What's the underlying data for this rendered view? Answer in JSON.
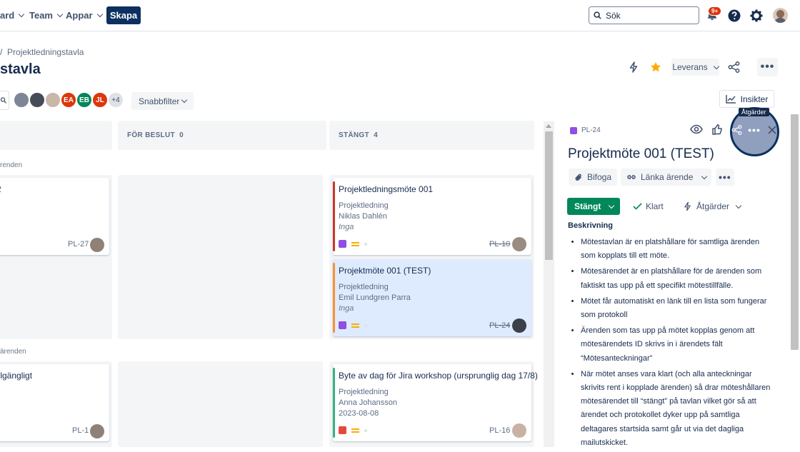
{
  "nav": {
    "items": [
      "ard",
      "Team",
      "Appar"
    ],
    "create": "Skapa",
    "search_placeholder": "Sök",
    "notifications_badge": "9+"
  },
  "page": {
    "breadcrumb": "Projektledningstavla",
    "title": "stavla",
    "release_btn": "Leverans",
    "insights_btn": "Insikter",
    "quick_filter": "Snabbfilter",
    "avatar_initials": [
      "EA",
      "EB",
      "JL"
    ],
    "avatar_more": "+4"
  },
  "board": {
    "columns": [
      {
        "name": "FÖR BESLUT",
        "count": "0"
      },
      {
        "name": "STÄNGT",
        "count": "4"
      }
    ],
    "swimlanes": [
      "renden",
      "ärenden"
    ],
    "left_cards": [
      {
        "title": "2",
        "key": "PL-27"
      },
      {
        "title": "illgängligt",
        "key": "PL-1"
      }
    ],
    "cards": [
      {
        "title": "Projektledningsmöte 001",
        "project": "Projektledning",
        "person": "Niklas Dahlén",
        "extra": "Inga",
        "key": "PL-10"
      },
      {
        "title": "Projektmöte 001 (TEST)",
        "project": "Projektledning",
        "person": "Emil Lundgren Parra",
        "extra": "Inga",
        "key": "PL-24"
      },
      {
        "title": "Byte av dag för Jira workshop (ursprunglig dag 17/8)",
        "project": "Projektledning",
        "person": "Anna Johansson",
        "extra": "2023-08-08",
        "key": "PL-16"
      }
    ]
  },
  "panel": {
    "issue_key": "PL-24",
    "title": "Projektmöte 001 (TEST)",
    "attach": "Bifoga",
    "link": "Länka ärende",
    "status": "Stängt",
    "done": "Klart",
    "actions": "Åtgärder",
    "tooltip": "Åtgärder",
    "desc_heading": "Beskrivning",
    "desc_items": [
      "Mötestavlan är en platshållare för samtliga ärenden som kopplats till ett möte.",
      "Mötesärendet är en platshållare för de ärenden som faktiskt tas upp på ett specifikt mötestillfälle.",
      "Mötet får automatiskt en länk till en lista som fungerar som protokoll",
      "Ärenden som tas upp på mötet kopplas genom att mötesärendets ID skrivs in i ärendets fält “Mötesanteckningar”",
      "När mötet anses vara klart (och alla anteckningar skrivits rent i kopplade ärenden) så drar möteshållaren mötesärendet till “stängt” på tavlan vilket gör så att ärendet och protokollet dyker upp på samtliga deltagares startsida samt går ut via det dagliga mailutskicket."
    ]
  },
  "colors": {
    "brand": "#0c3060",
    "status_green": "#00875a",
    "story_purple": "#904ee2",
    "bug_red": "#e5493a",
    "priority_yellow": "#ffab00"
  }
}
